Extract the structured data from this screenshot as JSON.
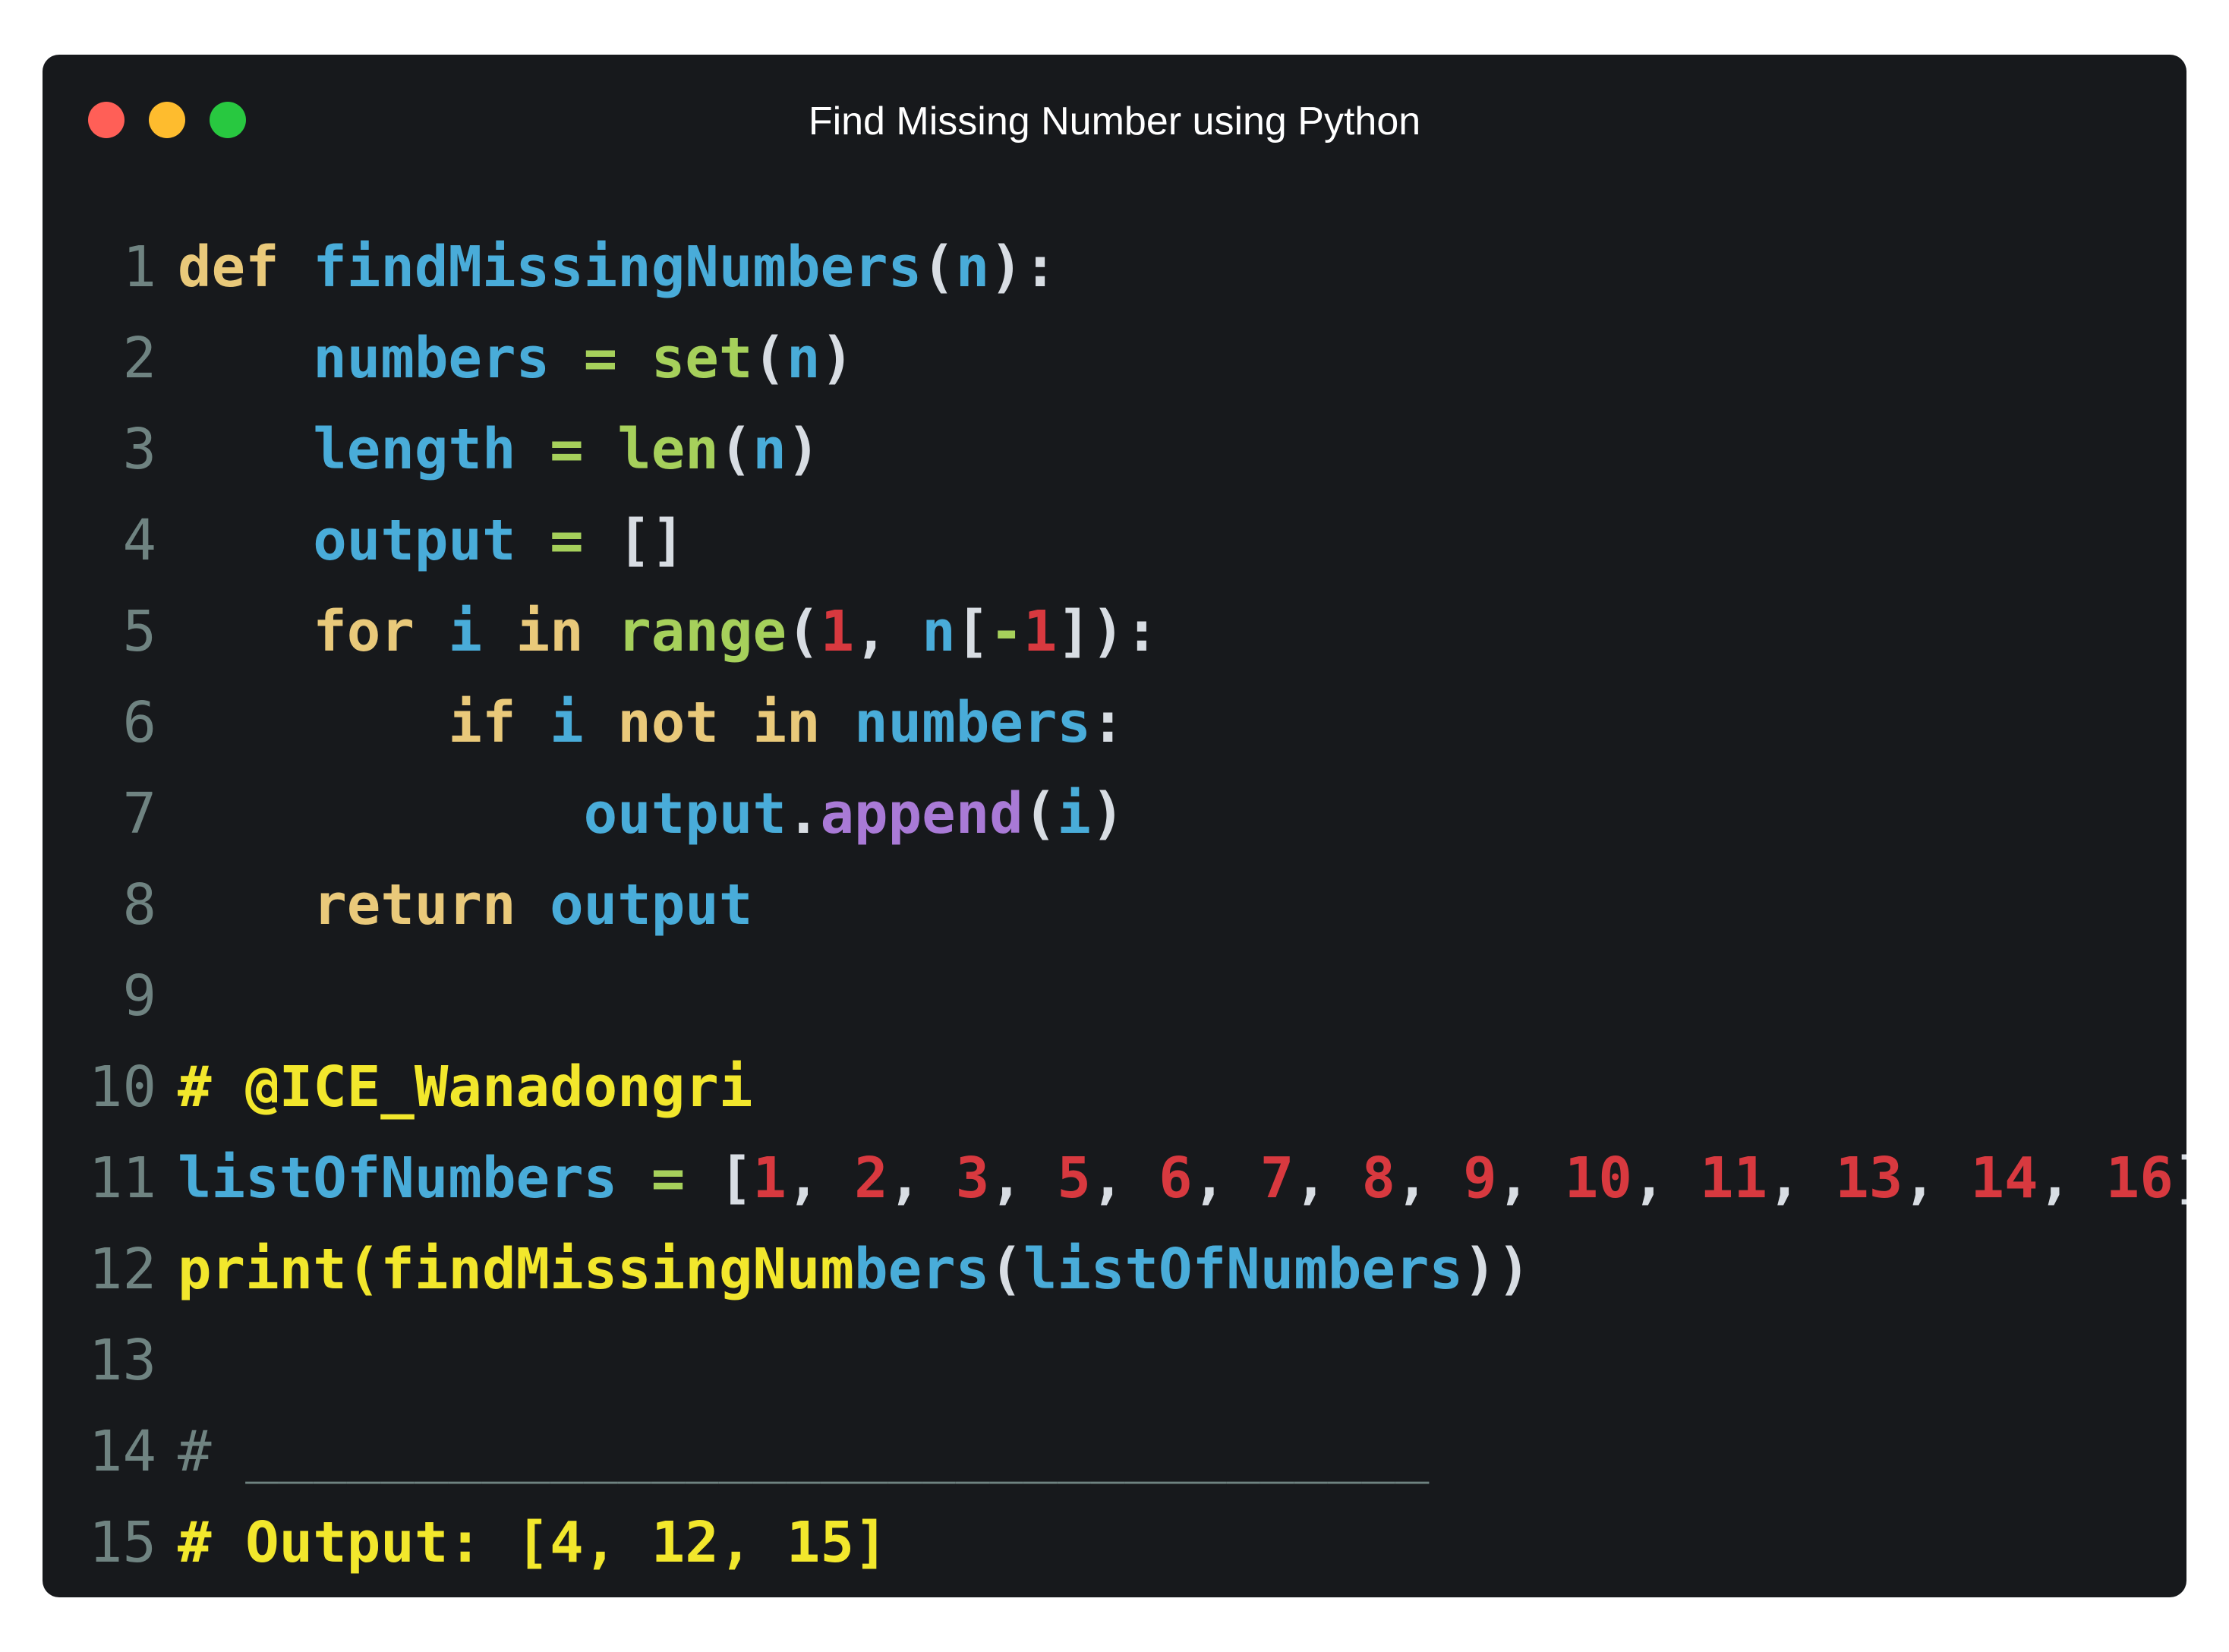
{
  "window": {
    "title": "Find Missing Number using Python",
    "buttons": [
      "close",
      "minimize",
      "maximize"
    ],
    "colors": {
      "background": "#17191c",
      "close": "#ff5f57",
      "minimize": "#febc2e",
      "maximize": "#28c840"
    }
  },
  "code": {
    "language": "python",
    "lines": [
      {
        "n": "1",
        "tokens": [
          {
            "t": "def",
            "c": "kw"
          },
          {
            "t": " ",
            "c": "punct"
          },
          {
            "t": "findMissingNumbers",
            "c": "name"
          },
          {
            "t": "(",
            "c": "punct"
          },
          {
            "t": "n",
            "c": "name"
          },
          {
            "t": "):",
            "c": "punct"
          }
        ]
      },
      {
        "n": "2",
        "tokens": [
          {
            "t": "    ",
            "c": "punct"
          },
          {
            "t": "numbers",
            "c": "name"
          },
          {
            "t": " = ",
            "c": "op"
          },
          {
            "t": "set",
            "c": "builtin"
          },
          {
            "t": "(",
            "c": "punct"
          },
          {
            "t": "n",
            "c": "name"
          },
          {
            "t": ")",
            "c": "punct"
          }
        ]
      },
      {
        "n": "3",
        "tokens": [
          {
            "t": "    ",
            "c": "punct"
          },
          {
            "t": "length",
            "c": "name"
          },
          {
            "t": " = ",
            "c": "op"
          },
          {
            "t": "len",
            "c": "builtin"
          },
          {
            "t": "(",
            "c": "punct"
          },
          {
            "t": "n",
            "c": "name"
          },
          {
            "t": ")",
            "c": "punct"
          }
        ]
      },
      {
        "n": "4",
        "tokens": [
          {
            "t": "    ",
            "c": "punct"
          },
          {
            "t": "output",
            "c": "name"
          },
          {
            "t": " = ",
            "c": "op"
          },
          {
            "t": "[]",
            "c": "punct"
          }
        ]
      },
      {
        "n": "5",
        "tokens": [
          {
            "t": "    ",
            "c": "punct"
          },
          {
            "t": "for",
            "c": "kw"
          },
          {
            "t": " ",
            "c": "punct"
          },
          {
            "t": "i",
            "c": "name"
          },
          {
            "t": " ",
            "c": "punct"
          },
          {
            "t": "in",
            "c": "kw"
          },
          {
            "t": " ",
            "c": "punct"
          },
          {
            "t": "range",
            "c": "builtin"
          },
          {
            "t": "(",
            "c": "punct"
          },
          {
            "t": "1",
            "c": "num"
          },
          {
            "t": ", ",
            "c": "punct"
          },
          {
            "t": "n",
            "c": "name"
          },
          {
            "t": "[",
            "c": "punct"
          },
          {
            "t": "-",
            "c": "op"
          },
          {
            "t": "1",
            "c": "num"
          },
          {
            "t": "]):",
            "c": "punct"
          }
        ]
      },
      {
        "n": "6",
        "tokens": [
          {
            "t": "        ",
            "c": "punct"
          },
          {
            "t": "if",
            "c": "kw"
          },
          {
            "t": " ",
            "c": "punct"
          },
          {
            "t": "i",
            "c": "name"
          },
          {
            "t": " ",
            "c": "punct"
          },
          {
            "t": "not",
            "c": "kw"
          },
          {
            "t": " ",
            "c": "punct"
          },
          {
            "t": "in",
            "c": "kw"
          },
          {
            "t": " ",
            "c": "punct"
          },
          {
            "t": "numbers",
            "c": "name"
          },
          {
            "t": ":",
            "c": "punct"
          }
        ]
      },
      {
        "n": "7",
        "tokens": [
          {
            "t": "            ",
            "c": "punct"
          },
          {
            "t": "output",
            "c": "name"
          },
          {
            "t": ".",
            "c": "punct"
          },
          {
            "t": "append",
            "c": "method"
          },
          {
            "t": "(",
            "c": "punct"
          },
          {
            "t": "i",
            "c": "name"
          },
          {
            "t": ")",
            "c": "punct"
          }
        ]
      },
      {
        "n": "8",
        "tokens": [
          {
            "t": "    ",
            "c": "punct"
          },
          {
            "t": "return",
            "c": "kw"
          },
          {
            "t": " ",
            "c": "punct"
          },
          {
            "t": "output",
            "c": "name"
          }
        ]
      },
      {
        "n": "9",
        "tokens": []
      },
      {
        "n": "10",
        "tokens": [
          {
            "t": "# @ICE_Wanadongri",
            "c": "comment"
          }
        ]
      },
      {
        "n": "11",
        "tokens": [
          {
            "t": "listOfNumbers",
            "c": "name"
          },
          {
            "t": " = ",
            "c": "op"
          },
          {
            "t": "[",
            "c": "punct"
          },
          {
            "t": "1",
            "c": "num"
          },
          {
            "t": ", ",
            "c": "punct"
          },
          {
            "t": "2",
            "c": "num"
          },
          {
            "t": ", ",
            "c": "punct"
          },
          {
            "t": "3",
            "c": "num"
          },
          {
            "t": ", ",
            "c": "punct"
          },
          {
            "t": "5",
            "c": "num"
          },
          {
            "t": ", ",
            "c": "punct"
          },
          {
            "t": "6",
            "c": "num"
          },
          {
            "t": ", ",
            "c": "punct"
          },
          {
            "t": "7",
            "c": "num"
          },
          {
            "t": ", ",
            "c": "punct"
          },
          {
            "t": "8",
            "c": "num"
          },
          {
            "t": ", ",
            "c": "punct"
          },
          {
            "t": "9",
            "c": "num"
          },
          {
            "t": ", ",
            "c": "punct"
          },
          {
            "t": "10",
            "c": "num"
          },
          {
            "t": ", ",
            "c": "punct"
          },
          {
            "t": "11",
            "c": "num"
          },
          {
            "t": ", ",
            "c": "punct"
          },
          {
            "t": "13",
            "c": "num"
          },
          {
            "t": ", ",
            "c": "punct"
          },
          {
            "t": "14",
            "c": "num"
          },
          {
            "t": ", ",
            "c": "punct"
          },
          {
            "t": "16",
            "c": "num"
          },
          {
            "t": "]",
            "c": "punct"
          }
        ]
      },
      {
        "n": "12",
        "tokens": [
          {
            "t": "print(findMissingNum",
            "c": "fn-yellow"
          },
          {
            "t": "bers",
            "c": "name"
          },
          {
            "t": "(",
            "c": "punct"
          },
          {
            "t": "listOfNumbers",
            "c": "name"
          },
          {
            "t": "))",
            "c": "punct"
          }
        ]
      },
      {
        "n": "13",
        "tokens": []
      },
      {
        "n": "14",
        "tokens": [
          {
            "t": "# ___________________________________",
            "c": "dim"
          }
        ]
      },
      {
        "n": "15",
        "tokens": [
          {
            "t": "# Output: [4, 12, 15]",
            "c": "comment"
          }
        ]
      }
    ]
  }
}
